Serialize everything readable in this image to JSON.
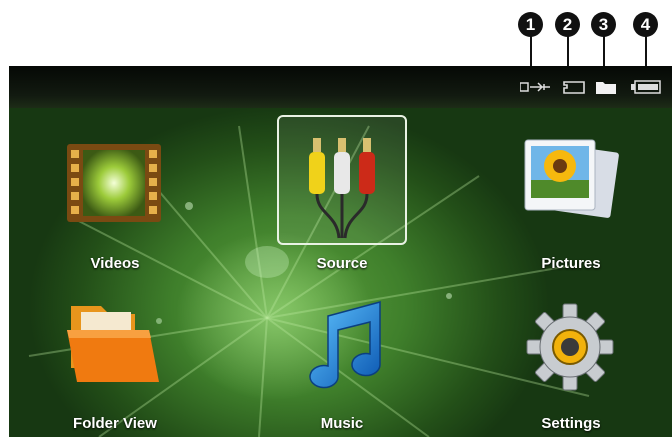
{
  "callouts": [
    "1",
    "2",
    "3",
    "4"
  ],
  "status_icons": [
    "usb-icon",
    "sd-card-icon",
    "folder-icon",
    "battery-icon"
  ],
  "menu": {
    "items": [
      {
        "label": "Videos",
        "icon": "film-strip-icon"
      },
      {
        "label": "Source",
        "icon": "av-cable-icon",
        "selected": true
      },
      {
        "label": "Pictures",
        "icon": "photo-icon"
      },
      {
        "label": "Folder View",
        "icon": "folder-icon"
      },
      {
        "label": "Music",
        "icon": "music-note-icon"
      },
      {
        "label": "Settings",
        "icon": "gear-icon"
      }
    ]
  },
  "colors": {
    "selection_border": "#e9f2e4",
    "background": "#3f7f2b",
    "label": "#ffffff"
  }
}
